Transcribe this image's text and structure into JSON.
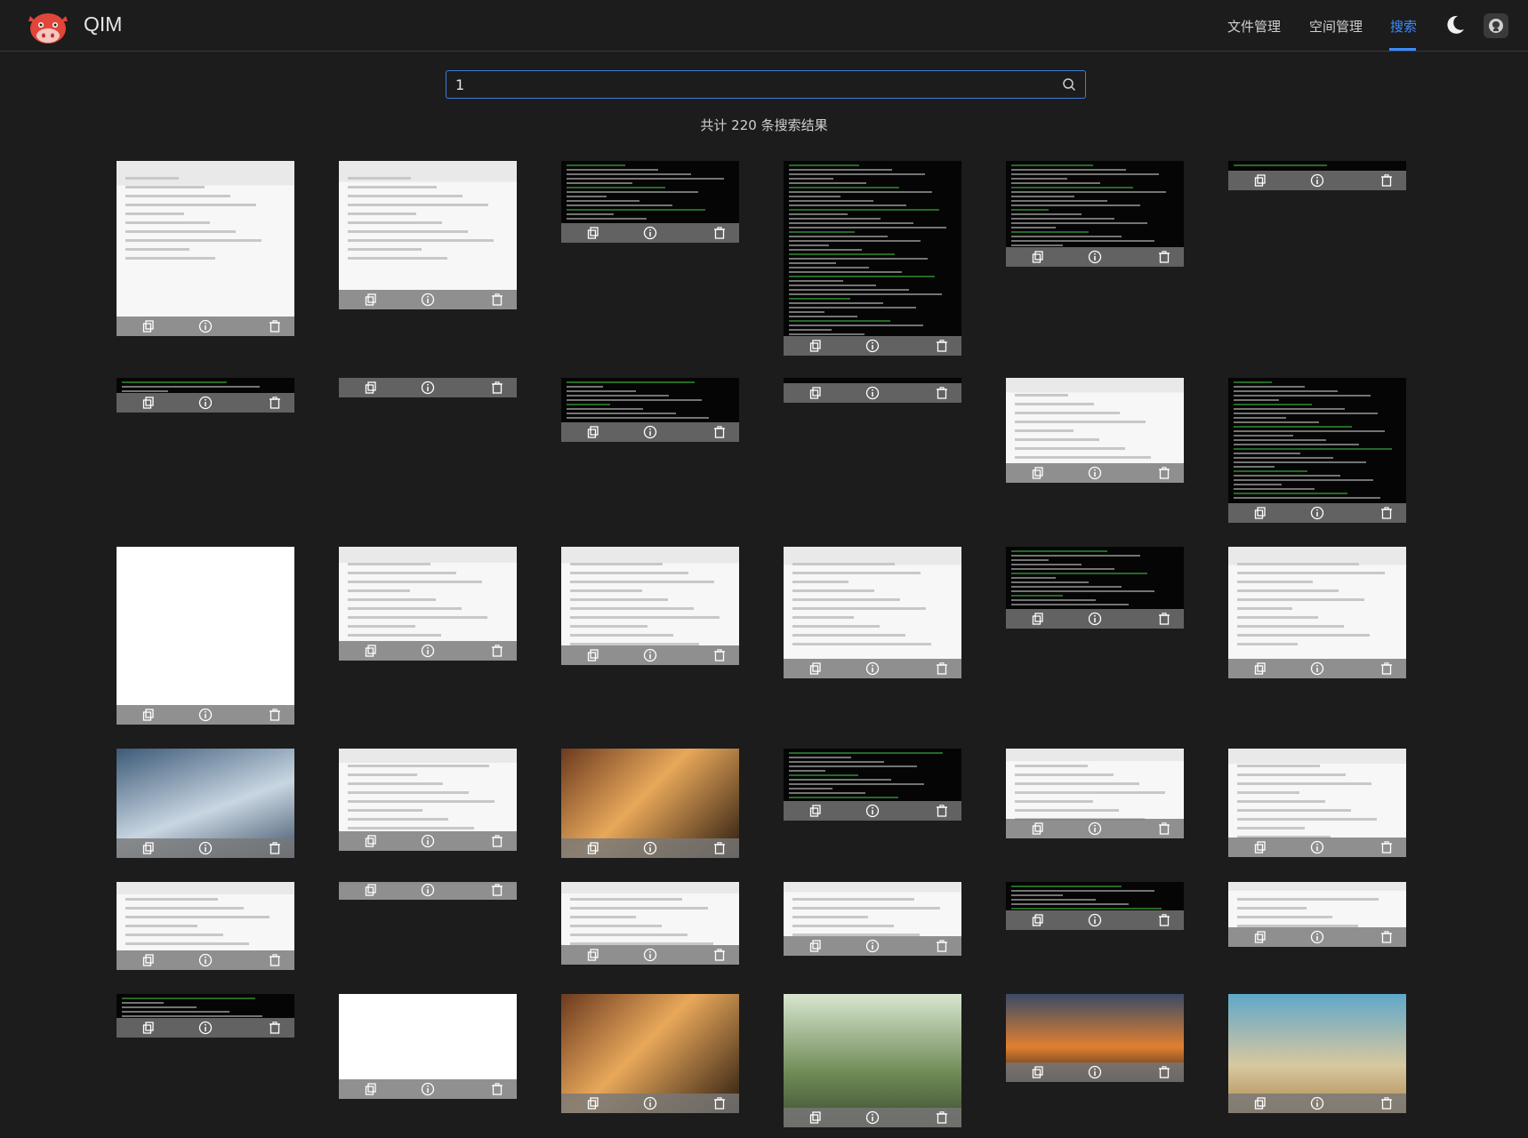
{
  "header": {
    "brand": "QIM",
    "nav": [
      {
        "label": "文件管理",
        "active": false
      },
      {
        "label": "空间管理",
        "active": false
      },
      {
        "label": "搜索",
        "active": true
      }
    ],
    "accent_color": "#3d8bff"
  },
  "search": {
    "value": "1",
    "result_text": "共计 220 条搜索结果"
  },
  "icons": {
    "logo": "cow-logo-icon",
    "theme": "moon-icon",
    "github": "github-icon",
    "search": "search-icon",
    "copy": "copy-icon",
    "info": "info-icon",
    "delete": "trash-icon"
  },
  "results": {
    "count": 36,
    "card_actions": [
      "copy",
      "info",
      "delete"
    ]
  }
}
